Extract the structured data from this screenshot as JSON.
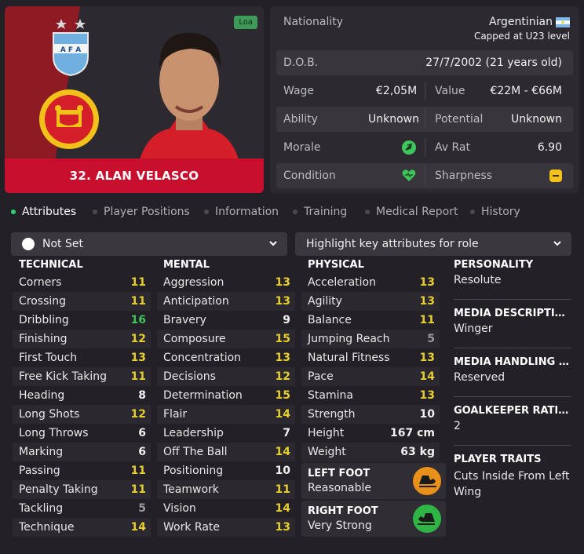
{
  "player": {
    "name": "32. ALAN VELASCO",
    "loan_badge": "Loa"
  },
  "info": {
    "nationality_label": "Nationality",
    "nationality_value": "Argentinian",
    "nationality_sub": "Capped at U23 level",
    "dob_label": "D.O.B.",
    "dob_value": "27/7/2002 (21 years old)",
    "wage_label": "Wage",
    "wage_value": "€2,05M",
    "value_label": "Value",
    "value_value": "€22M - €66M",
    "ability_label": "Ability",
    "ability_value": "Unknown",
    "potential_label": "Potential",
    "potential_value": "Unknown",
    "morale_label": "Morale",
    "avrat_label": "Av Rat",
    "avrat_value": "6.90",
    "condition_label": "Condition",
    "sharpness_label": "Sharpness"
  },
  "tabs": [
    "Attributes",
    "Player Positions",
    "Information",
    "Training",
    "Medical Report",
    "History"
  ],
  "filters": {
    "role": "Not Set",
    "highlight": "Highlight key attributes for role"
  },
  "technical": {
    "title": "TECHNICAL",
    "items": [
      {
        "name": "Corners",
        "value": "11",
        "color": "#e6cf2e"
      },
      {
        "name": "Crossing",
        "value": "11",
        "color": "#e6cf2e"
      },
      {
        "name": "Dribbling",
        "value": "16",
        "color": "#3ec65b"
      },
      {
        "name": "Finishing",
        "value": "12",
        "color": "#e6cf2e"
      },
      {
        "name": "First Touch",
        "value": "13",
        "color": "#e6cf2e"
      },
      {
        "name": "Free Kick Taking",
        "value": "11",
        "color": "#e6cf2e"
      },
      {
        "name": "Heading",
        "value": "8",
        "color": "#f0f0f0"
      },
      {
        "name": "Long Shots",
        "value": "12",
        "color": "#e6cf2e"
      },
      {
        "name": "Long Throws",
        "value": "6",
        "color": "#f0f0f0"
      },
      {
        "name": "Marking",
        "value": "6",
        "color": "#f0f0f0"
      },
      {
        "name": "Passing",
        "value": "11",
        "color": "#e6cf2e"
      },
      {
        "name": "Penalty Taking",
        "value": "11",
        "color": "#e6cf2e"
      },
      {
        "name": "Tackling",
        "value": "5",
        "color": "#9a9a9e"
      },
      {
        "name": "Technique",
        "value": "14",
        "color": "#e6cf2e"
      }
    ]
  },
  "mental": {
    "title": "MENTAL",
    "items": [
      {
        "name": "Aggression",
        "value": "13",
        "color": "#e6cf2e"
      },
      {
        "name": "Anticipation",
        "value": "13",
        "color": "#e6cf2e"
      },
      {
        "name": "Bravery",
        "value": "9",
        "color": "#f0f0f0"
      },
      {
        "name": "Composure",
        "value": "15",
        "color": "#e6cf2e"
      },
      {
        "name": "Concentration",
        "value": "13",
        "color": "#e6cf2e"
      },
      {
        "name": "Decisions",
        "value": "12",
        "color": "#e6cf2e"
      },
      {
        "name": "Determination",
        "value": "15",
        "color": "#e6cf2e"
      },
      {
        "name": "Flair",
        "value": "14",
        "color": "#e6cf2e"
      },
      {
        "name": "Leadership",
        "value": "7",
        "color": "#f0f0f0"
      },
      {
        "name": "Off The Ball",
        "value": "14",
        "color": "#e6cf2e"
      },
      {
        "name": "Positioning",
        "value": "10",
        "color": "#f0f0f0"
      },
      {
        "name": "Teamwork",
        "value": "11",
        "color": "#e6cf2e"
      },
      {
        "name": "Vision",
        "value": "14",
        "color": "#e6cf2e"
      },
      {
        "name": "Work Rate",
        "value": "13",
        "color": "#e6cf2e"
      }
    ]
  },
  "physical": {
    "title": "PHYSICAL",
    "items": [
      {
        "name": "Acceleration",
        "value": "13",
        "color": "#e6cf2e"
      },
      {
        "name": "Agility",
        "value": "13",
        "color": "#e6cf2e"
      },
      {
        "name": "Balance",
        "value": "11",
        "color": "#e6cf2e"
      },
      {
        "name": "Jumping Reach",
        "value": "5",
        "color": "#9a9a9e"
      },
      {
        "name": "Natural Fitness",
        "value": "13",
        "color": "#e6cf2e"
      },
      {
        "name": "Pace",
        "value": "14",
        "color": "#e6cf2e"
      },
      {
        "name": "Stamina",
        "value": "13",
        "color": "#e6cf2e"
      },
      {
        "name": "Strength",
        "value": "10",
        "color": "#f0f0f0"
      },
      {
        "name": "Height",
        "value": "167 cm",
        "color": "#f0f0f0"
      },
      {
        "name": "Weight",
        "value": "63 kg",
        "color": "#f0f0f0"
      }
    ]
  },
  "feet": {
    "left_label": "LEFT FOOT",
    "left_value": "Reasonable",
    "left_color": "#e8901a",
    "right_label": "RIGHT FOOT",
    "right_value": "Very Strong",
    "right_color": "#2fb446"
  },
  "personality": {
    "personality_title": "PERSONALITY",
    "personality_value": "Resolute",
    "media_desc_title": "MEDIA DESCRIPTION",
    "media_desc_value": "Winger",
    "media_handling_title": "MEDIA HANDLING ST...",
    "media_handling_value": "Reserved",
    "gk_title": "GOALKEEPER RATING",
    "gk_value": "2",
    "traits_title": "PLAYER TRAITS",
    "traits_value": "Cuts Inside From Left Wing"
  },
  "colors": {
    "accent": "#c8102e",
    "good": "#3ec65b",
    "mid": "#e6cf2e"
  }
}
